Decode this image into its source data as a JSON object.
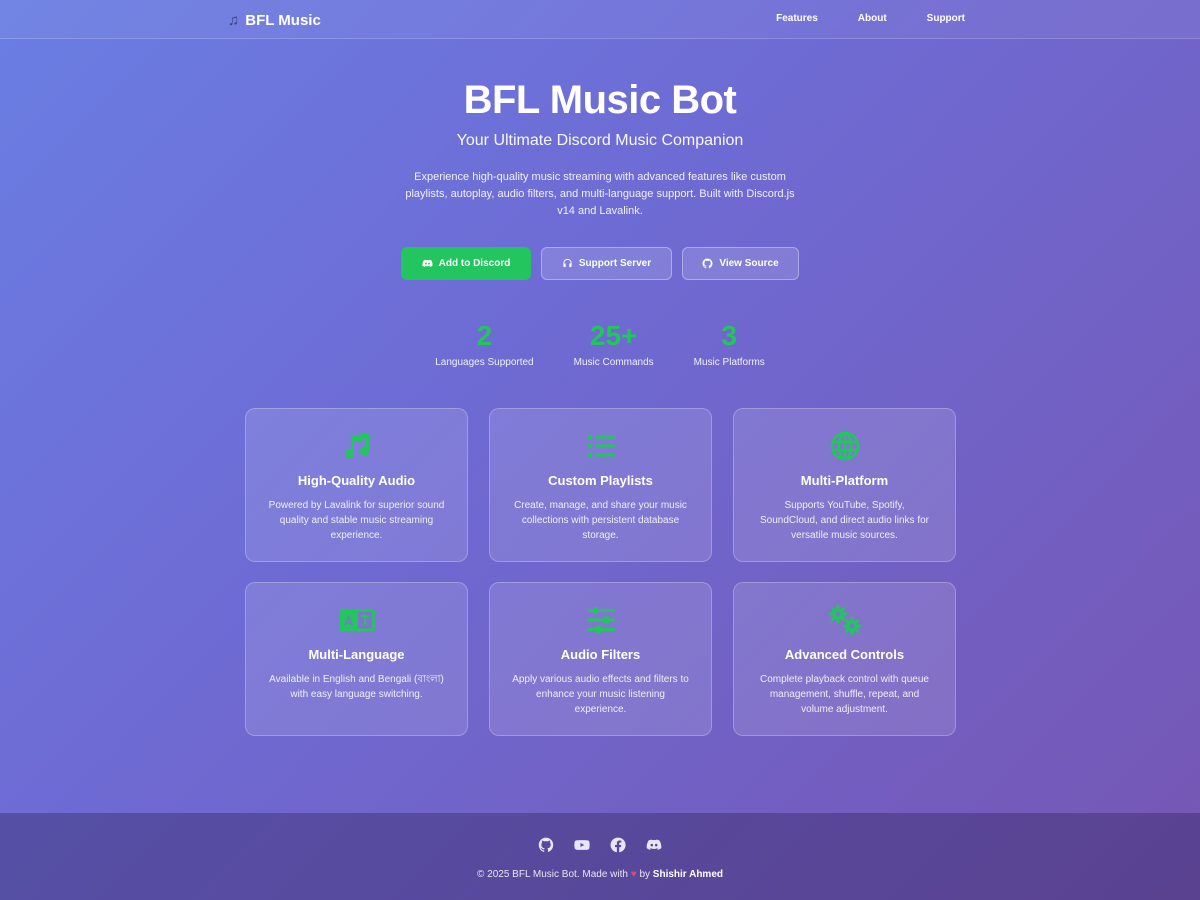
{
  "nav": {
    "brand": "BFL Music",
    "links": [
      "Features",
      "About",
      "Support"
    ]
  },
  "hero": {
    "title": "BFL Music Bot",
    "subtitle": "Your Ultimate Discord Music Companion",
    "description": "Experience high-quality music streaming with advanced features like custom playlists, autoplay, audio filters, and multi-language support. Built with Discord.js v14 and Lavalink."
  },
  "buttons": {
    "add": "Add to Discord",
    "support": "Support Server",
    "source": "View Source"
  },
  "stats": [
    {
      "value": "2",
      "label": "Languages Supported"
    },
    {
      "value": "25+",
      "label": "Music Commands"
    },
    {
      "value": "3",
      "label": "Music Platforms"
    }
  ],
  "features": [
    {
      "icon": "music-note-icon",
      "title": "High-Quality Audio",
      "desc": "Powered by Lavalink for superior sound quality and stable music streaming experience."
    },
    {
      "icon": "list-icon",
      "title": "Custom Playlists",
      "desc": "Create, manage, and share your music collections with persistent database storage."
    },
    {
      "icon": "globe-icon",
      "title": "Multi-Platform",
      "desc": "Supports YouTube, Spotify, SoundCloud, and direct audio links for versatile music sources."
    },
    {
      "icon": "language-icon",
      "title": "Multi-Language",
      "desc": "Available in English and Bengali (বাংলা) with easy language switching."
    },
    {
      "icon": "sliders-icon",
      "title": "Audio Filters",
      "desc": "Apply various audio effects and filters to enhance your music listening experience."
    },
    {
      "icon": "gears-icon",
      "title": "Advanced Controls",
      "desc": "Complete playback control with queue management, shuffle, repeat, and volume adjustment."
    }
  ],
  "footer": {
    "copy_prefix": "© 2025 BFL Music Bot. Made with",
    "copy_by": "by",
    "author": "Shishir Ahmed"
  },
  "colors": {
    "accent": "#22c55e",
    "heart": "#e0457b"
  }
}
